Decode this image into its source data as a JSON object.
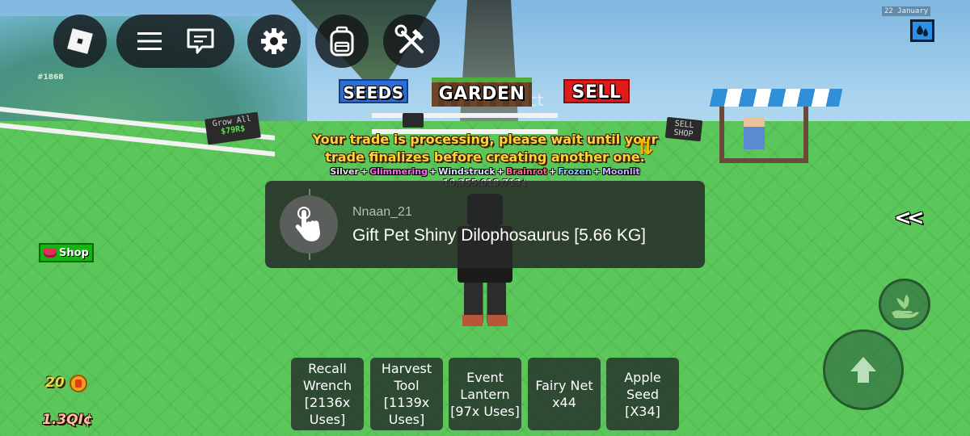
{
  "hud": {
    "date": "22 January",
    "weather_icon": "water-drops-icon"
  },
  "top_bar": {
    "roblox_icon": "roblox-logo-icon",
    "menu_icon": "hamburger-menu-icon",
    "chat_icon": "chat-icon",
    "settings_icon": "gear-icon",
    "backpack_icon": "backpack-icon",
    "tools_icon": "hammer-wrench-icon"
  },
  "tabs": {
    "seeds": "SEEDS",
    "garden": "GARDEN",
    "sell": "SELL",
    "ghost_text": "Collect"
  },
  "world_labels": {
    "avatar_tag": "#1868",
    "grow_sign_line1": "Grow All",
    "grow_sign_line2": "$79R$",
    "sell_sign_line1": "SELL",
    "sell_sign_line2": "SHOP"
  },
  "trade_message": {
    "line1": "Your trade is processing, please wait until your",
    "line2": "trade finalizes before creating another one."
  },
  "pet_tag": {
    "mutations": [
      "Silver",
      "Glimmering",
      "Windstruck",
      "Brainrot",
      "Frozen",
      "Moonlit"
    ],
    "separator": "+",
    "value": "10,355,018,713¢"
  },
  "prompt": {
    "username": "Nnaan_21",
    "action": "Gift Pet Shiny Dilophosaurus [5.66 KG]",
    "icon": "tap-hand-icon"
  },
  "right_controls": {
    "collapse_label": "<<",
    "shovel_icon": "hand-plant-icon",
    "jump_icon": "up-arrow-icon"
  },
  "left_panel": {
    "shop_label": "Shop",
    "seed_count": "20",
    "money": "1.3QI¢"
  },
  "hotbar": [
    {
      "label": "Recall Wrench [2136x Uses]"
    },
    {
      "label": "Harvest Tool [1139x Uses]"
    },
    {
      "label": "Event Lantern [97x Uses]"
    },
    {
      "label": "Fairy Net x44"
    },
    {
      "label": "Apple Seed [X34]"
    }
  ],
  "colors": {
    "seeds_tab": "#2b6fd6",
    "sell_tab": "#e01b1b",
    "trade_text": "#ffd23a",
    "ground": "#5bc659"
  }
}
